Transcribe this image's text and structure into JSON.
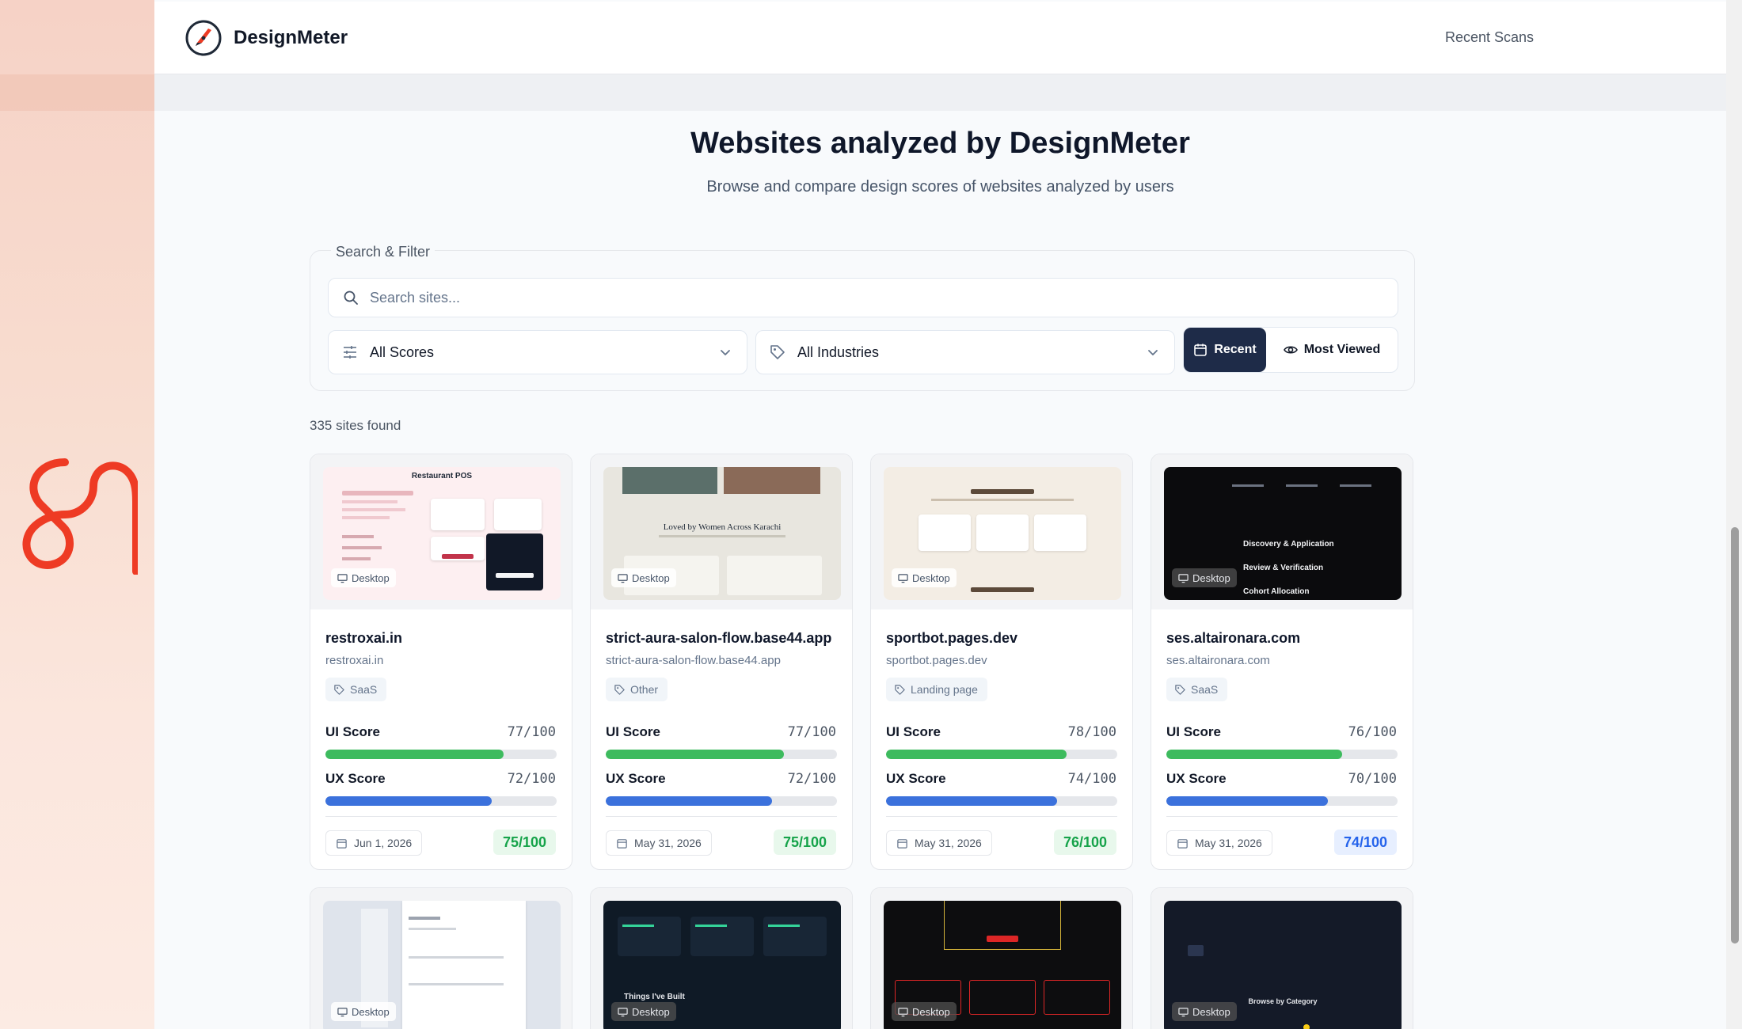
{
  "header": {
    "brand": "DesignMeter",
    "nav_recent": "Recent Scans"
  },
  "hero": {
    "title": "Websites analyzed by DesignMeter",
    "subtitle": "Browse and compare design scores of websites analyzed by users"
  },
  "filter": {
    "legend": "Search & Filter",
    "search_placeholder": "Search sites...",
    "scores_value": "All Scores",
    "industries_value": "All Industries",
    "sort_recent": "Recent",
    "sort_most_viewed": "Most Viewed"
  },
  "results": {
    "count_text": "335 sites found"
  },
  "labels": {
    "ui_score": "UI Score",
    "ux_score": "UX Score",
    "device": "Desktop"
  },
  "cards": [
    {
      "title": "restroxai.in",
      "url": "restroxai.in",
      "tag": "SaaS",
      "ui": 77,
      "ui_text": "77/100",
      "ux": 72,
      "ux_text": "72/100",
      "date": "Jun 1, 2026",
      "overall": "75/100",
      "overall_color": "#16a34a"
    },
    {
      "title": "strict-aura-salon-flow.base44.app",
      "url": "strict-aura-salon-flow.base44.app",
      "tag": "Other",
      "ui": 77,
      "ui_text": "77/100",
      "ux": 72,
      "ux_text": "72/100",
      "date": "May 31, 2026",
      "overall": "75/100",
      "overall_color": "#16a34a"
    },
    {
      "title": "sportbot.pages.dev",
      "url": "sportbot.pages.dev",
      "tag": "Landing page",
      "ui": 78,
      "ui_text": "78/100",
      "ux": 74,
      "ux_text": "74/100",
      "date": "May 31, 2026",
      "overall": "76/100",
      "overall_color": "#16a34a"
    },
    {
      "title": "ses.altaironara.com",
      "url": "ses.altaironara.com",
      "tag": "SaaS",
      "ui": 76,
      "ui_text": "76/100",
      "ux": 70,
      "ux_text": "70/100",
      "date": "May 31, 2026",
      "overall": "74/100",
      "overall_color": "#2563eb"
    }
  ],
  "thumb_texts": {
    "t1_heading": "Restaurant POS",
    "t2_heading": "Loved by Women Across Karachi",
    "t4_line1": "Discovery & Application",
    "t4_line2": "Review & Verification",
    "t4_line3": "Cohort Allocation",
    "t6_heading": "Things I've Built",
    "t8_heading": "Browse by Category"
  },
  "colors": {
    "accent_dark": "#1e2b48",
    "ui_bar": "#3dbb5e",
    "ux_bar": "#3b71dc",
    "brand_orange": "#ee3b24"
  }
}
